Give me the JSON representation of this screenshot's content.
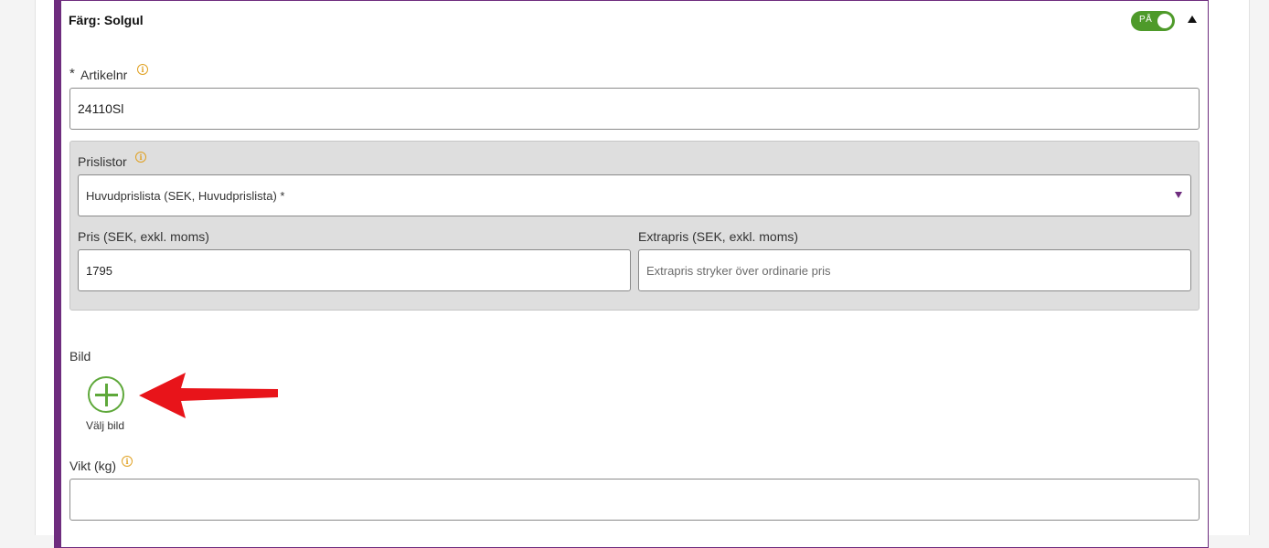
{
  "panel": {
    "title": "Färg: Solgul",
    "toggle_label": "PÅ",
    "accent_color": "#6e2c7e",
    "toggle_color": "#4e9a2a"
  },
  "article": {
    "required_mark": "*",
    "label": "Artikelnr",
    "value": "24110Sl"
  },
  "pricelists": {
    "label": "Prislistor",
    "selected": "Huvudprislista (SEK, Huvudprislista) *",
    "price_label": "Pris (SEK, exkl. moms)",
    "price_value": "1795",
    "extra_label": "Extrapris (SEK, exkl. moms)",
    "extra_placeholder": "Extrapris stryker över ordinarie pris"
  },
  "image": {
    "label": "Bild",
    "choose_label": "Välj bild",
    "annotation_color": "#e8141a"
  },
  "weight": {
    "label": "Vikt (kg)",
    "value": ""
  },
  "icons": {
    "info": "i"
  }
}
